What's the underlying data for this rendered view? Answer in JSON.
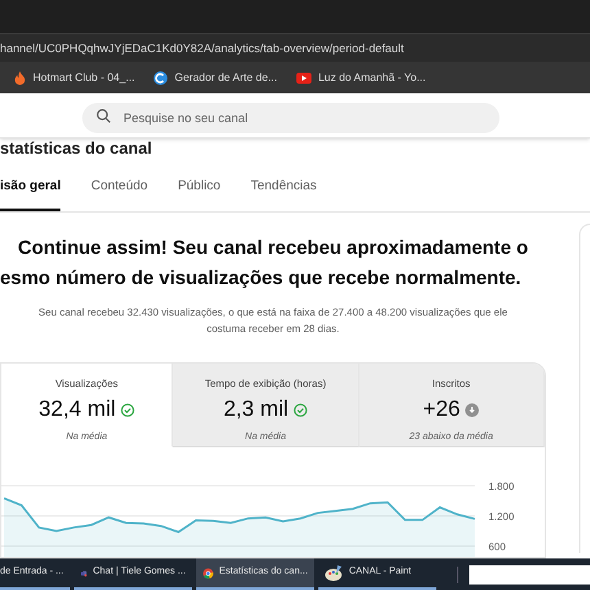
{
  "browser": {
    "url": "hannel/UC0PHQqhwJYjEDaC1Kd0Y82A/analytics/tab-overview/period-default",
    "bookmarks": [
      {
        "label": "Hotmart Club - 04_...",
        "kind": "flame"
      },
      {
        "label": "Gerador de Arte de...",
        "kind": "swirl"
      },
      {
        "label": "Luz do Amanhã - Yo...",
        "kind": "video"
      }
    ]
  },
  "search": {
    "placeholder": "Pesquise no seu canal"
  },
  "page_title": "statísticas do canal",
  "tabs": [
    {
      "label": "isão geral",
      "selected": true
    },
    {
      "label": "Conteúdo",
      "selected": false
    },
    {
      "label": "Público",
      "selected": false
    },
    {
      "label": "Tendências",
      "selected": false
    }
  ],
  "headline": [
    "Continue assim! Seu canal recebeu aproximadamente o",
    "esmo número de visualizações que recebe normalmente."
  ],
  "summary": "Seu canal recebeu 32.430 visualizações, o que está na faixa de 27.400 a 48.200 visualizações que ele costuma receber em 28 dias.",
  "metrics": [
    {
      "label": "Visualizações",
      "value": "32,4 mil",
      "kind": "ok",
      "note": "Na média",
      "selected": true
    },
    {
      "label": "Tempo de exibição (horas)",
      "value": "2,3 mil",
      "kind": "ok",
      "note": "Na média",
      "selected": false
    },
    {
      "label": "Inscritos",
      "value": "+26",
      "kind": "below",
      "note": "23 abaixo da média",
      "selected": false
    }
  ],
  "chart": {
    "chart_data": {
      "type": "area",
      "ylim": [
        600,
        1800
      ],
      "yticks": [
        {
          "value": 600,
          "label": "600"
        },
        {
          "value": 1200,
          "label": "1.200"
        },
        {
          "value": 1800,
          "label": "1.800"
        }
      ],
      "series": [
        {
          "color": "#4fb3c9",
          "values": [
            1550,
            1410,
            970,
            900,
            970,
            1020,
            1170,
            1060,
            1050,
            1000,
            880,
            1110,
            1100,
            1060,
            1150,
            1170,
            1090,
            1150,
            1260,
            1300,
            1340,
            1450,
            1470,
            1120,
            1120,
            1370,
            1230,
            1140
          ]
        }
      ]
    }
  },
  "taskbar": [
    {
      "label": "de Entrada - ...",
      "kind": "none",
      "selected": false
    },
    {
      "label": "Chat | Tiele Gomes ...",
      "kind": "teams",
      "selected": false
    },
    {
      "label": "Estatísticas do can...",
      "kind": "chrome",
      "selected": true
    },
    {
      "label": "CANAL - Paint",
      "kind": "paint",
      "selected": false
    }
  ]
}
